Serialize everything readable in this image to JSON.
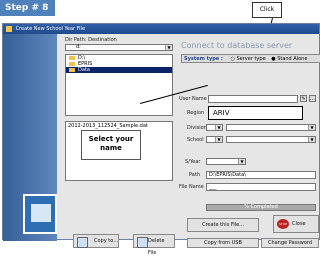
{
  "step_label": "Step # 8",
  "callout_click": "Click",
  "callout_select_name": "Select your name",
  "window": {
    "title": "Create New School Year File",
    "dir_path_label": "Dir Path: Destination",
    "drive_value": "d:",
    "tree": [
      "D:\\",
      "EPRIS",
      "Data"
    ],
    "files": [
      "2012-2013_112524_Sample.dat"
    ],
    "connect_title": "Connect to database server",
    "system_type_label": "System type :",
    "system_type_options": [
      "Server type",
      "Stand Alone"
    ],
    "user_name_label": "User Name",
    "region_label": "Region",
    "region_value": "ARIV",
    "division_label": "Division",
    "school_label": "School",
    "sy_label": "S/Year",
    "path_label": "Path",
    "path_value": "D:\\EPRIS\\Data\\",
    "file_name_label": "File Name",
    "file_name_value": "___",
    "progress_value": "% Completed",
    "buttons": {
      "create": "Create this File...",
      "close": "Close",
      "stop": "STOP",
      "copy_usb": "Copy from USB",
      "change_password": "Change Password",
      "copy_to": "Copy to...",
      "delete": "Delete File"
    }
  }
}
